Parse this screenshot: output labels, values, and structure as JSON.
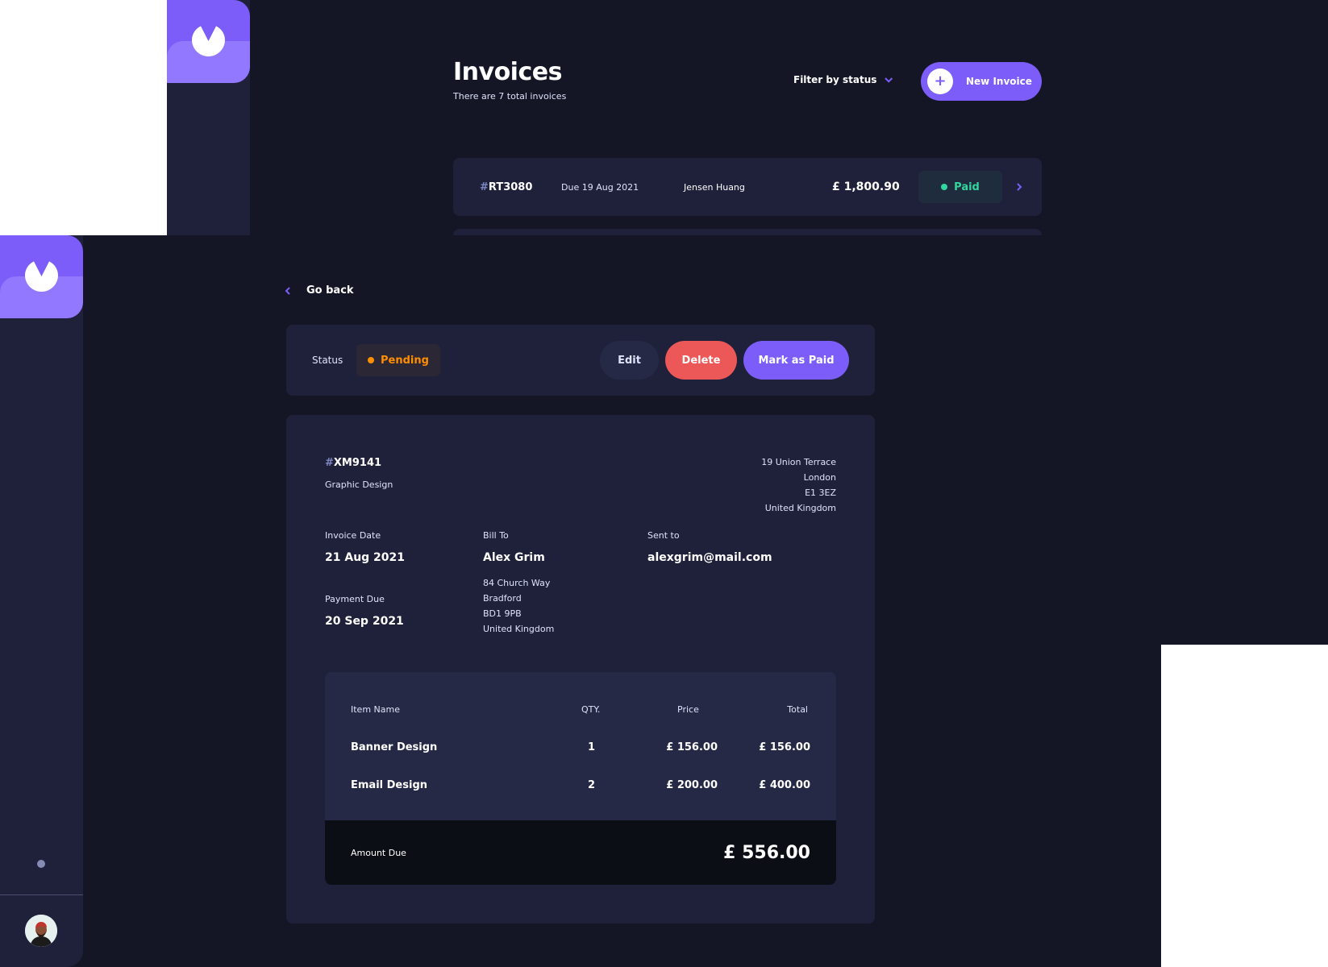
{
  "invoices_list": {
    "title": "Invoices",
    "subtitle": "There are 7 total invoices",
    "filter_label": "Filter by status",
    "new_invoice_label": "New Invoice",
    "rows": [
      {
        "id_hash": "#",
        "id": "RT3080",
        "due": "Due  19 Aug 2021",
        "client": "Jensen Huang",
        "amount": "£ 1,800.90",
        "status": "Paid"
      }
    ]
  },
  "detail": {
    "go_back_label": "Go back",
    "status_label": "Status",
    "status_value": "Pending",
    "edit_label": "Edit",
    "delete_label": "Delete",
    "mark_paid_label": "Mark as Paid",
    "id_hash": "#",
    "id": "XM9141",
    "description": "Graphic Design",
    "sender_address": {
      "street": "19 Union Terrace",
      "city": "London",
      "post_code": "E1 3EZ",
      "country": "United Kingdom"
    },
    "invoice_date_label": "Invoice Date",
    "invoice_date": "21 Aug 2021",
    "payment_due_label": "Payment Due",
    "payment_due": "20 Sep 2021",
    "bill_to_label": "Bill To",
    "client_name": "Alex Grim",
    "client_address": {
      "street": "84 Church Way",
      "city": "Bradford",
      "post_code": "BD1 9PB",
      "country": "United Kingdom"
    },
    "sent_to_label": "Sent to",
    "client_email": "alexgrim@mail.com",
    "items_headers": {
      "name": "Item Name",
      "qty": "QTY.",
      "price": "Price",
      "total": "Total"
    },
    "items": [
      {
        "name": "Banner Design",
        "qty": "1",
        "price": "£ 156.00",
        "total": "£ 156.00"
      },
      {
        "name": "Email Design",
        "qty": "2",
        "price": "£ 200.00",
        "total": "£ 400.00"
      }
    ],
    "amount_due_label": "Amount Due",
    "amount_due": "£ 556.00"
  },
  "icons": {
    "logo": "logo-icon",
    "plus": "plus-icon",
    "chevron_down": "chevron-down-icon",
    "chevron_right": "chevron-right-icon",
    "chevron_left": "chevron-left-icon",
    "theme_toggle": "theme-toggle-icon",
    "avatar": "avatar"
  },
  "colors": {
    "background": "#141625",
    "surface": "#1e2139",
    "accent": "#7c5dfa",
    "accent_light": "#9277ff",
    "danger": "#ec5757",
    "paid": "#33d69f",
    "pending": "#ff8f00"
  }
}
